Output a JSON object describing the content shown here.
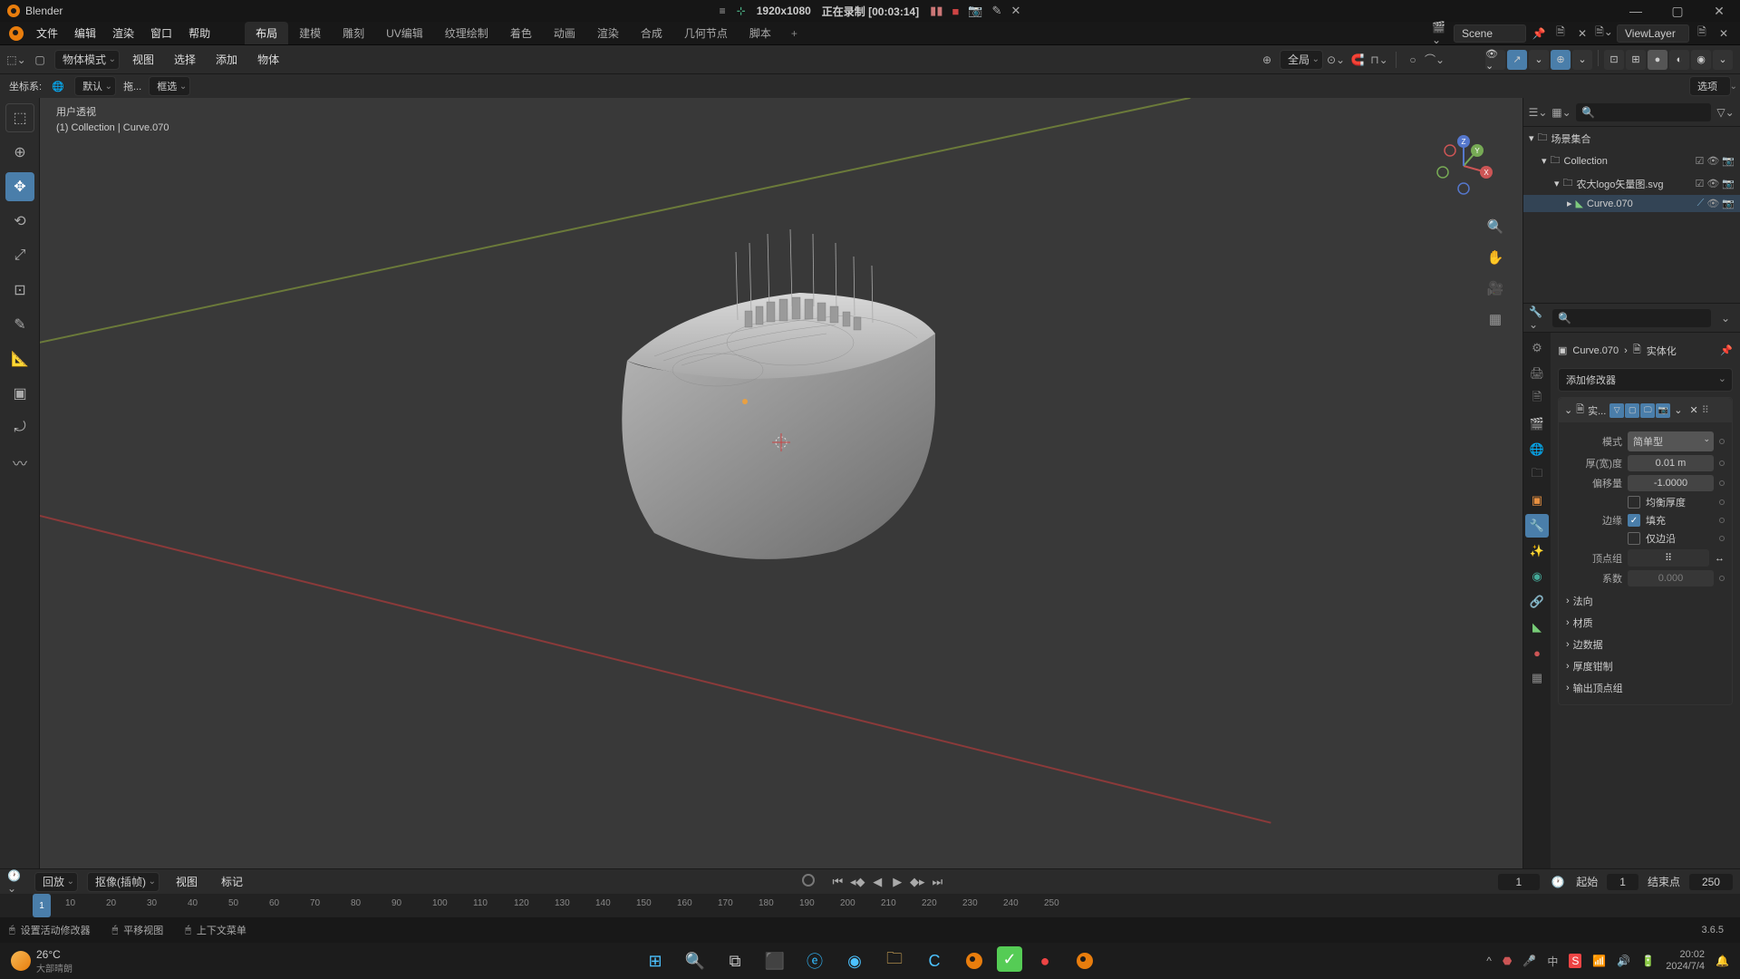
{
  "app": {
    "name": "Blender"
  },
  "titlebar_center": {
    "hamburger": "≡",
    "pin": "📌",
    "resolution": "1920x1080",
    "recording": "正在录制 [00:03:14]"
  },
  "menus": {
    "file": "文件",
    "edit": "编辑",
    "render": "渲染",
    "window": "窗口",
    "help": "帮助"
  },
  "workspaces": {
    "layout": "布局",
    "modeling": "建模",
    "sculpting": "雕刻",
    "uv": "UV编辑",
    "texpaint": "纹理绘制",
    "shading": "着色",
    "animation": "动画",
    "rendering": "渲染",
    "compositing": "合成",
    "geonodes": "几何节点",
    "scripting": "脚本"
  },
  "scene": {
    "label": "Scene",
    "viewlayer": "ViewLayer"
  },
  "header": {
    "mode": "物体模式",
    "view": "视图",
    "select": "选择",
    "add": "添加",
    "object": "物体",
    "global": "全局"
  },
  "subheader": {
    "coord_label": "坐标系:",
    "coord_value": "默认",
    "drag": "拖...",
    "box": "框选",
    "options": "选项"
  },
  "viewport": {
    "line1": "用户透视",
    "line2": "(1) Collection | Curve.070"
  },
  "outliner": {
    "scene_collection": "场景集合",
    "collection": "Collection",
    "svg_file": "农大logo矢量图.svg",
    "curve": "Curve.070"
  },
  "props": {
    "breadcrumb_obj": "Curve.070",
    "breadcrumb_mod": "实体化",
    "add_modifier": "添加修改器",
    "modifier_name": "实...",
    "mode_label": "模式",
    "mode_value": "简单型",
    "thickness_label": "厚(宽)度",
    "thickness_value": "0.01 m",
    "offset_label": "偏移量",
    "offset_value": "-1.0000",
    "even_thickness": "均衡厚度",
    "rim_label": "边缘",
    "rim_fill": "填充",
    "rim_only": "仅边沿",
    "vgroup_label": "顶点组",
    "factor_label": "系数",
    "factor_value": "0.000",
    "normals": "法向",
    "materials": "材质",
    "edge_data": "边数据",
    "thickness_clamp": "厚度钳制",
    "output_vgroups": "输出顶点组"
  },
  "timeline": {
    "playback": "回放",
    "keying": "抠像(插帧)",
    "view": "视图",
    "marker": "标记",
    "current": "1",
    "start_label": "起始",
    "start": "1",
    "end_label": "结束点",
    "end": "250",
    "ticks": [
      "10",
      "20",
      "30",
      "40",
      "50",
      "60",
      "70",
      "80",
      "90",
      "100",
      "110",
      "120",
      "130",
      "140",
      "150",
      "160",
      "170",
      "180",
      "190",
      "200",
      "210",
      "220",
      "230",
      "240",
      "250"
    ]
  },
  "status": {
    "item1": "设置活动修改器",
    "item2": "平移视图",
    "item3": "上下文菜单",
    "version": "3.6.5"
  },
  "taskbar": {
    "temp": "26°C",
    "weather": "大部晴朗",
    "time": "20:02",
    "date": "2024/7/4"
  }
}
